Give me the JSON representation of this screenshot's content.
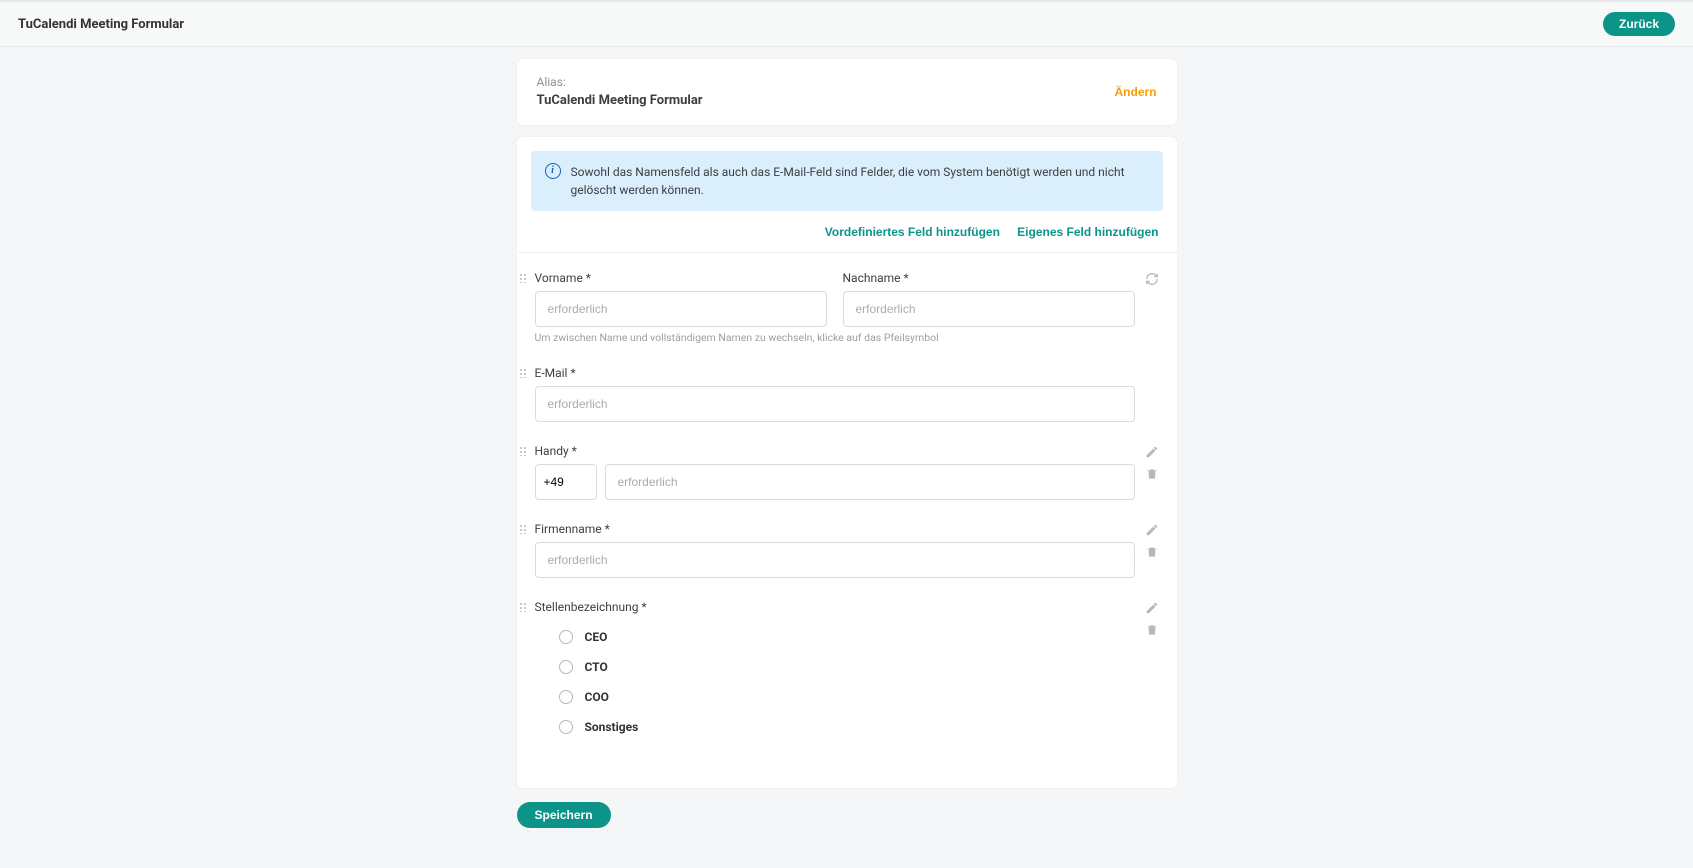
{
  "header": {
    "title": "TuCalendi Meeting Formular",
    "back_label": "Zurück"
  },
  "alias": {
    "label": "Alias:",
    "value": "TuCalendi Meeting Formular",
    "change_label": "Ändern"
  },
  "info_banner": {
    "text": "Sowohl das Namensfeld als auch das E-Mail-Feld sind Felder, die vom System benötigt werden und nicht gelöscht werden können."
  },
  "links": {
    "add_predefined": "Vordefiniertes Feld hinzufügen",
    "add_custom": "Eigenes Feld hinzufügen"
  },
  "fields": {
    "name": {
      "first_label": "Vorname *",
      "first_placeholder": "erforderlich",
      "last_label": "Nachname *",
      "last_placeholder": "erforderlich",
      "helper": "Um zwischen Name und vollständigem Namen zu wechseln, klicke auf das Pfeilsymbol"
    },
    "email": {
      "label": "E-Mail *",
      "placeholder": "erforderlich"
    },
    "phone": {
      "label": "Handy *",
      "prefix": "+49",
      "placeholder": "erforderlich"
    },
    "company": {
      "label": "Firmenname *",
      "placeholder": "erforderlich"
    },
    "jobtitle": {
      "label": "Stellenbezeichnung *",
      "options": [
        "CEO",
        "CTO",
        "COO",
        "Sonstiges"
      ]
    }
  },
  "footer": {
    "save_label": "Speichern"
  }
}
